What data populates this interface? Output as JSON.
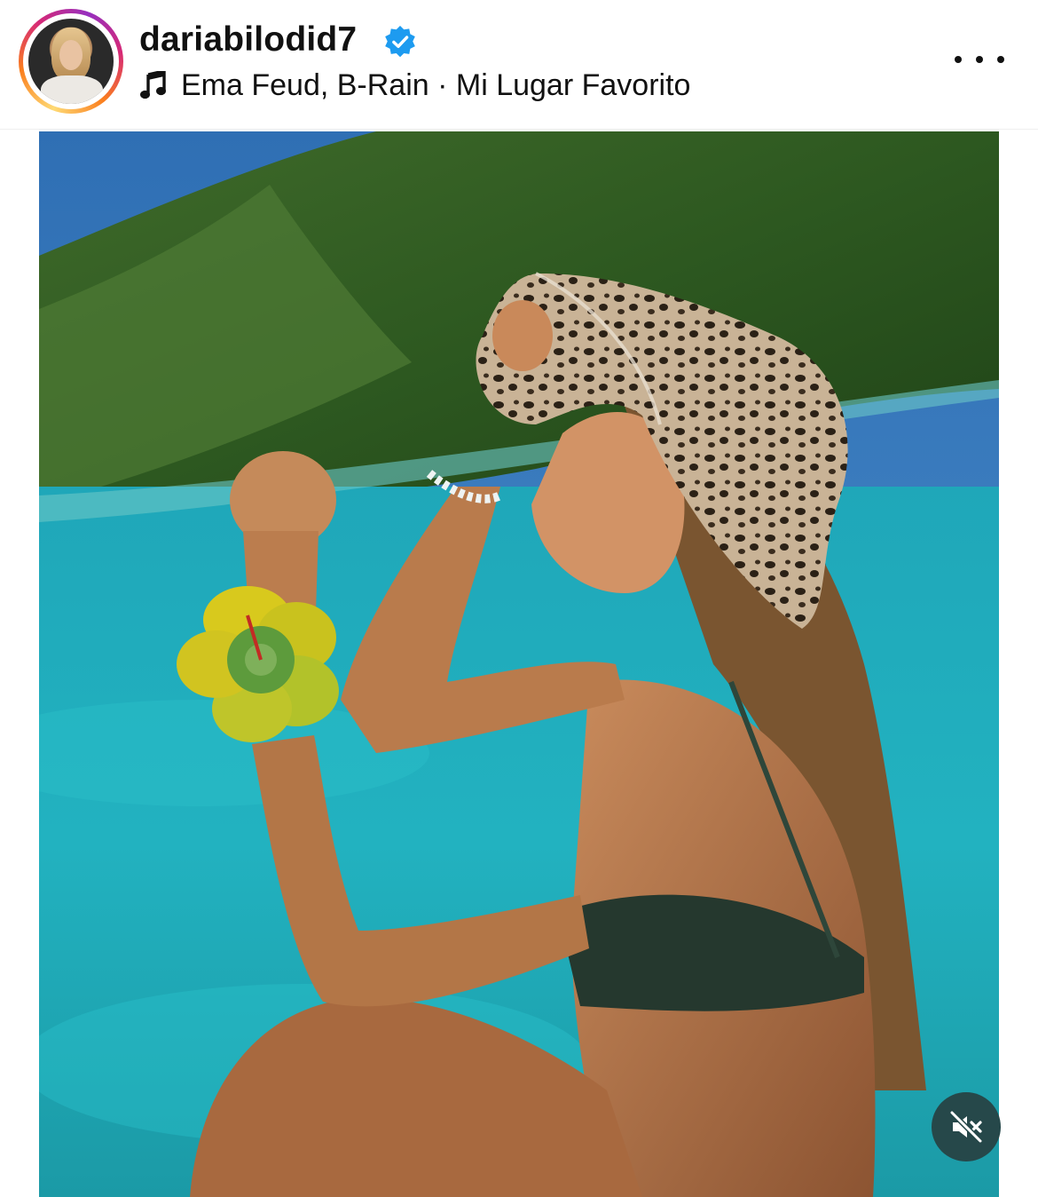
{
  "post": {
    "username": "dariabilodid7",
    "verified": true,
    "audio": "Ema Feud, B-Rain · Mi Lugar Favorito"
  },
  "icons": {
    "verified": "verified-badge-icon",
    "music": "music-note-icon",
    "more": "more-options-icon",
    "mute": "speaker-muted-icon"
  },
  "colors": {
    "verified_blue": "#1d9bf0",
    "mute_button_bg": "#26484a"
  }
}
